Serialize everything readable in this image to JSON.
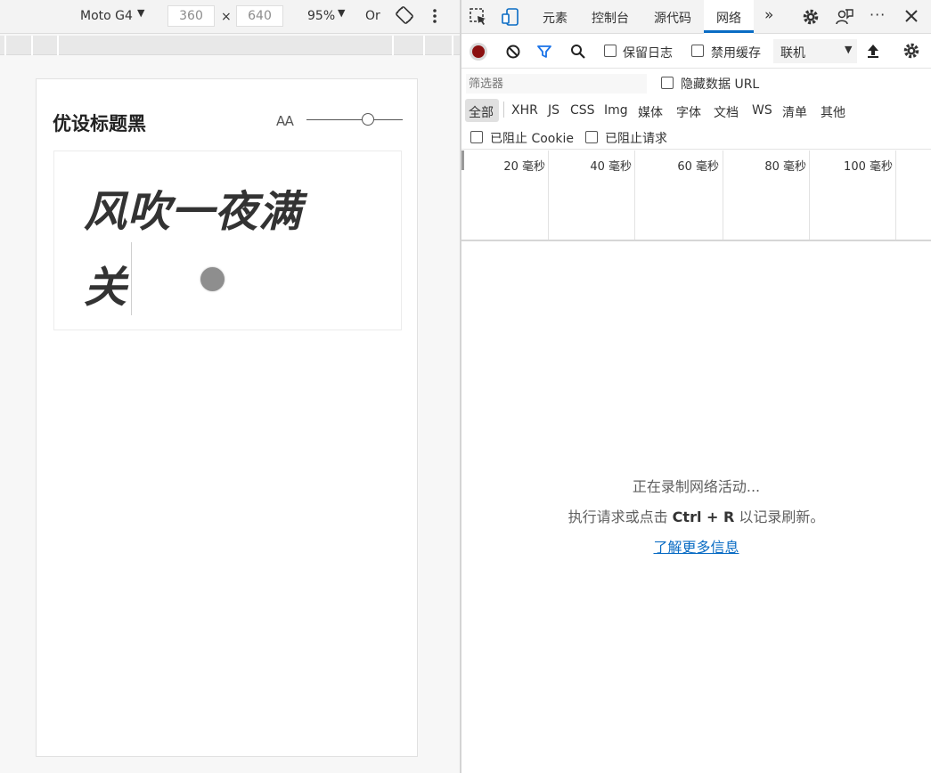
{
  "device_toolbar": {
    "device": "Moto G4",
    "width": "360",
    "times": "×",
    "height": "640",
    "zoom": "95%",
    "throttle": "Or"
  },
  "page": {
    "title": "优设标题黑",
    "text_size_label": "AA",
    "slider_value": 0.6,
    "preview_line1": "风吹一夜满",
    "preview_line2": "关"
  },
  "devtools": {
    "tabs": [
      "元素",
      "控制台",
      "源代码",
      "网络"
    ],
    "active_tab": "网络",
    "more_tabs": "»",
    "toolbar": {
      "preserve_log": "保留日志",
      "disable_cache": "禁用缓存",
      "throttle_select": "联机"
    },
    "filter": {
      "placeholder": "筛选器",
      "hide_data_url": "隐藏数据 URL",
      "types": [
        "全部",
        "XHR",
        "JS",
        "CSS",
        "Img",
        "媒体",
        "字体",
        "文档",
        "WS",
        "清单",
        "其他"
      ],
      "blocked_cookies": "已阻止 Cookie",
      "blocked_requests": "已阻止请求"
    },
    "timeline_ticks": [
      "20 毫秒",
      "40 毫秒",
      "60 毫秒",
      "80 毫秒",
      "100 毫秒"
    ],
    "empty_state": {
      "line1": "正在录制网络活动...",
      "line2_prefix": "执行请求或点击 ",
      "line2_shortcut": "Ctrl + R",
      "line2_suffix": " 以记录刷新。",
      "link": "了解更多信息"
    }
  },
  "colors": {
    "accent": "#0a6cc4",
    "record": "#8b1010",
    "filter_icon": "#1a73e8"
  }
}
